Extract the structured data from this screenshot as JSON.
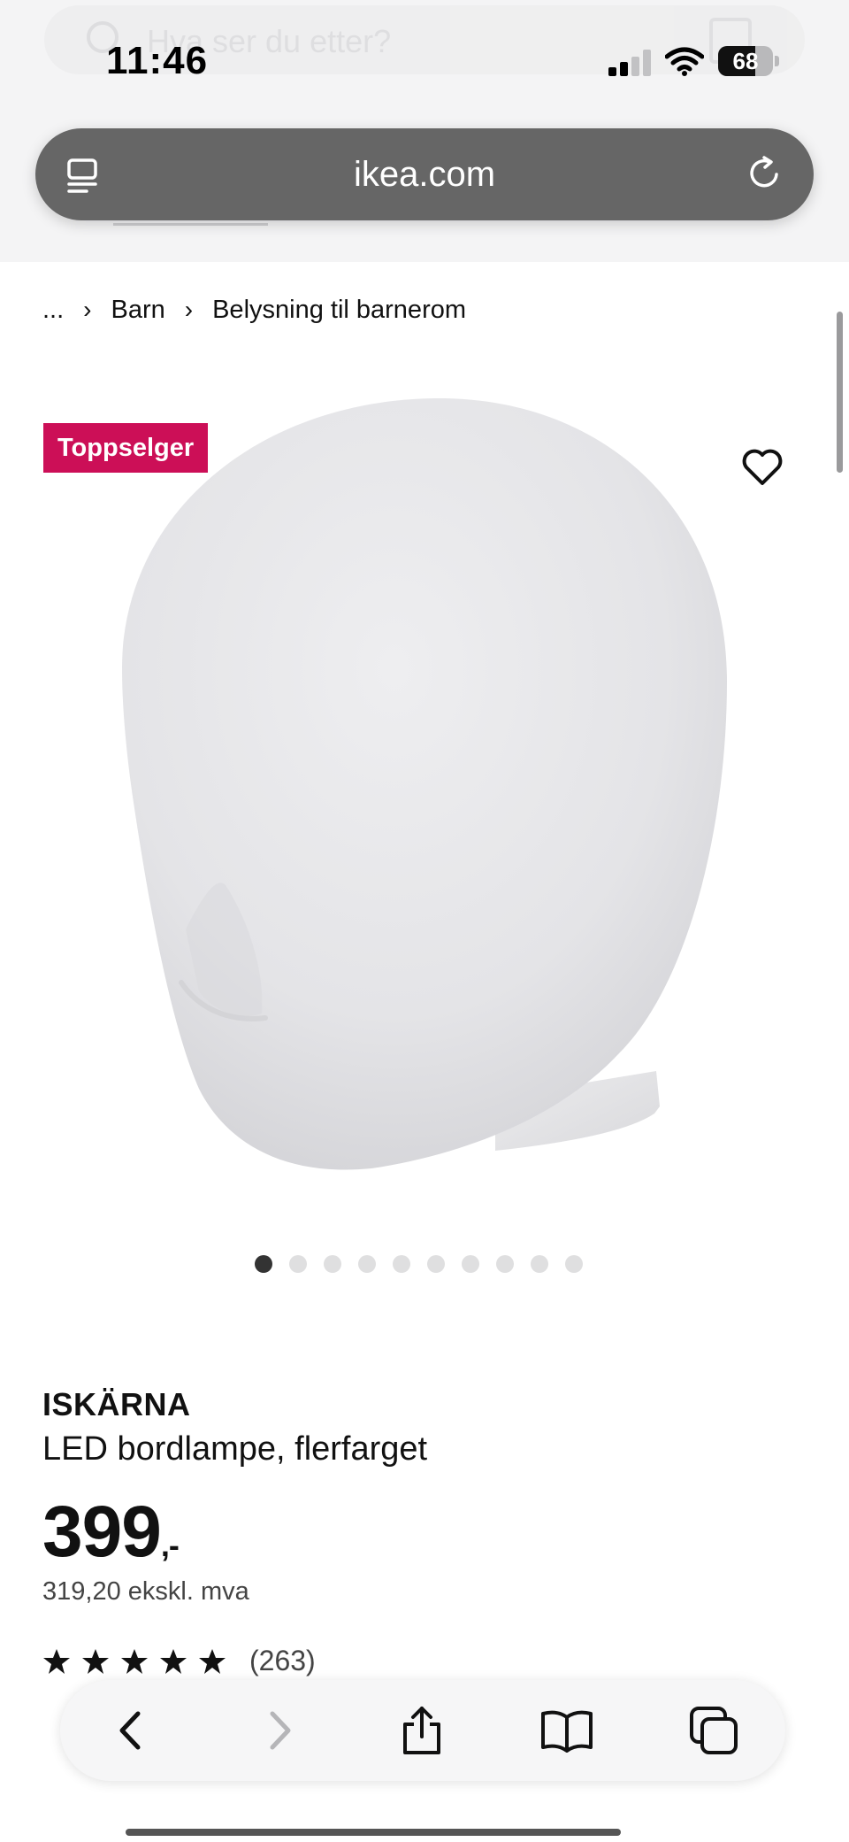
{
  "status_bar": {
    "time": "11:46",
    "battery": "68"
  },
  "background_page": {
    "search_placeholder": "Hva ser du etter?"
  },
  "browser": {
    "url": "ikea.com"
  },
  "breadcrumb": {
    "ellipsis": "...",
    "items": [
      "Barn",
      "Belysning til barnerom"
    ]
  },
  "product": {
    "badge": "Toppselger",
    "name": "ISKÄRNA",
    "description": "LED bordlampe, flerfarget",
    "price": "399",
    "price_suffix": ",-",
    "price_ex_vat": "319,20 ekskl. mva",
    "rating": {
      "stars": 5,
      "count": "(263)"
    },
    "image_index": 1,
    "image_count": 10
  },
  "colors": {
    "badge": "#cc0f57",
    "url_bar": "#666666",
    "text": "#111111"
  },
  "icons": {
    "tabs": "tabs-icon",
    "reload": "reload-icon",
    "favourite": "heart-icon",
    "back": "back-arrow-icon",
    "forward": "forward-arrow-icon",
    "share": "share-icon",
    "bookmarks": "book-icon",
    "all_tabs": "tabs-stack-icon"
  }
}
